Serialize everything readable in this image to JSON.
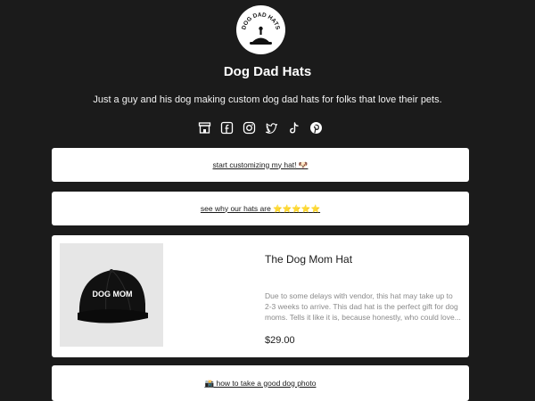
{
  "profile": {
    "avatar_text": "DOG DAD HATS",
    "name": "Dog Dad Hats",
    "bio": "Just a guy and his dog making custom dog dad hats for folks that love their pets."
  },
  "socials": [
    {
      "icon": "store-icon"
    },
    {
      "icon": "facebook-icon"
    },
    {
      "icon": "instagram-icon"
    },
    {
      "icon": "twitter-icon"
    },
    {
      "icon": "tiktok-icon"
    },
    {
      "icon": "pinterest-icon"
    }
  ],
  "links": {
    "customize_label": "start customizing my hat! 🐶",
    "why_label": "see why our hats are ⭐⭐⭐⭐⭐",
    "photo_label": "📸 how to take a good dog photo"
  },
  "product": {
    "hat_text": "DOG MOM",
    "title": "The Dog Mom Hat",
    "description": "Due to some delays with vendor, this hat may take up to 2-3 weeks to arrive. This dad hat is the perfect gift for dog moms. Tells it like it is, because honestly, who could love...",
    "price": "$29.00"
  },
  "colors": {
    "background": "#1b1b1b",
    "card": "#ffffff",
    "muted_text": "#8a8a8a"
  }
}
